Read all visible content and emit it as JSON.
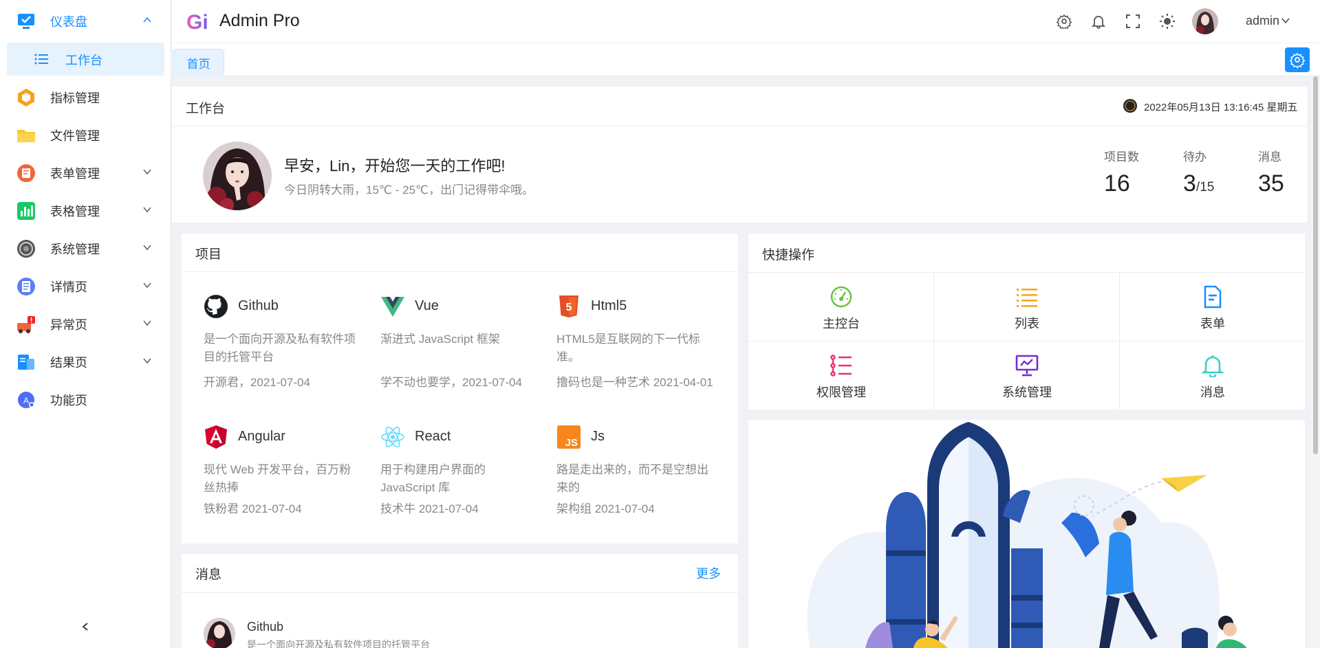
{
  "sidebar": {
    "items": [
      {
        "label": "仪表盘",
        "icon": "monitor-icon",
        "expandable": true,
        "expanded": true
      },
      {
        "label": "指标管理",
        "icon": "hexagon-icon",
        "expandable": false
      },
      {
        "label": "文件管理",
        "icon": "folder-icon",
        "expandable": false
      },
      {
        "label": "表单管理",
        "icon": "form-icon",
        "expandable": true
      },
      {
        "label": "表格管理",
        "icon": "table-chart-icon",
        "expandable": true
      },
      {
        "label": "系统管理",
        "icon": "system-icon",
        "expandable": true
      },
      {
        "label": "详情页",
        "icon": "detail-icon",
        "expandable": true
      },
      {
        "label": "异常页",
        "icon": "error-icon",
        "expandable": true
      },
      {
        "label": "结果页",
        "icon": "result-icon",
        "expandable": true
      },
      {
        "label": "功能页",
        "icon": "function-icon",
        "expandable": false
      }
    ],
    "submenu_active": "工作台"
  },
  "header": {
    "app_title": "Admin Pro",
    "username": "admin"
  },
  "tabs": [
    {
      "label": "首页"
    }
  ],
  "workbench": {
    "title": "工作台",
    "datetime": "2022年05月13日 13:16:45 星期五",
    "greeting": "早安，Lin，开始您一天的工作吧!",
    "weather": "今日阴转大雨，15℃ - 25℃，出门记得带伞哦。",
    "stats": [
      {
        "label": "项目数",
        "value": "16",
        "total": ""
      },
      {
        "label": "待办",
        "value": "3",
        "total": "/15"
      },
      {
        "label": "消息",
        "value": "35",
        "total": ""
      }
    ]
  },
  "projects": {
    "title": "项目",
    "items": [
      {
        "name": "Github",
        "icon": "github-icon",
        "desc": "是一个面向开源及私有软件项目的托管平台",
        "foot": "开源君，2021-07-04"
      },
      {
        "name": "Vue",
        "icon": "vue-icon",
        "desc": "渐进式 JavaScript 框架",
        "foot": "学不动也要学，2021-07-04"
      },
      {
        "name": "Html5",
        "icon": "html5-icon",
        "desc": "HTML5是互联网的下一代标准。",
        "foot": "撸码也是一种艺术 2021-04-01"
      },
      {
        "name": "Angular",
        "icon": "angular-icon",
        "desc": "现代 Web 开发平台，百万粉丝热捧",
        "foot": "铁粉君 2021-07-04"
      },
      {
        "name": "React",
        "icon": "react-icon",
        "desc": "用于构建用户界面的 JavaScript 库",
        "foot": "技术牛 2021-07-04"
      },
      {
        "name": "Js",
        "icon": "js-icon",
        "desc": "路是走出来的，而不是空想出来的",
        "foot": "架构组 2021-07-04"
      }
    ]
  },
  "quick_actions": {
    "title": "快捷操作",
    "items": [
      {
        "label": "主控台",
        "icon": "dashboard-icon",
        "color": "#67c23a"
      },
      {
        "label": "列表",
        "icon": "list-icon",
        "color": "#f5a623"
      },
      {
        "label": "表单",
        "icon": "document-icon",
        "color": "#1890ff"
      },
      {
        "label": "权限管理",
        "icon": "permission-icon",
        "color": "#eb2f6b"
      },
      {
        "label": "系统管理",
        "icon": "monitor-chart-icon",
        "color": "#722ed1"
      },
      {
        "label": "消息",
        "icon": "bell-icon",
        "color": "#36cfc9"
      }
    ]
  },
  "messages": {
    "title": "消息",
    "more": "更多",
    "items": [
      {
        "title": "Github",
        "desc": "是一个面向开源及私有软件项目的托管平台"
      }
    ]
  }
}
